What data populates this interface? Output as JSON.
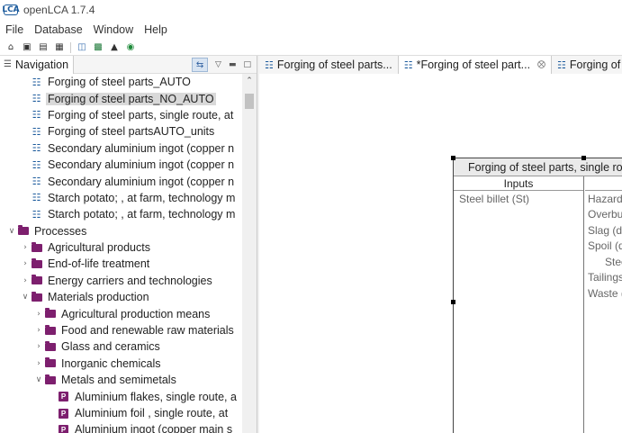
{
  "app": {
    "title": "openLCA 1.7.4",
    "logo": "LCA"
  },
  "menu": [
    "File",
    "Database",
    "Window",
    "Help"
  ],
  "toolbar_icons": [
    "home-icon",
    "save-icon",
    "save-as-icon",
    "save-all-icon",
    "console-icon",
    "excel-icon",
    "import-icon",
    "run-icon"
  ],
  "nav": {
    "title": "Navigation",
    "items": [
      {
        "label": "Forging of steel parts_AUTO",
        "type": "system",
        "level": 2
      },
      {
        "label": "Forging of steel parts_NO_AUTO",
        "type": "system",
        "level": 2,
        "selected": true
      },
      {
        "label": "Forging of steel parts, single route, at",
        "type": "system",
        "level": 2
      },
      {
        "label": "Forging of steel partsAUTO_units",
        "type": "system",
        "level": 2
      },
      {
        "label": "Secondary aluminium ingot (copper n",
        "type": "system",
        "level": 2
      },
      {
        "label": "Secondary aluminium ingot (copper n",
        "type": "system",
        "level": 2
      },
      {
        "label": "Secondary aluminium ingot (copper n",
        "type": "system",
        "level": 2
      },
      {
        "label": "Starch potato; , at farm, technology m",
        "type": "system",
        "level": 2
      },
      {
        "label": "Starch potato; , at farm, technology m",
        "type": "system",
        "level": 2
      },
      {
        "label": "Processes",
        "type": "folder",
        "level": 1,
        "expand": "open"
      },
      {
        "label": "Agricultural products",
        "type": "folder",
        "level": 2,
        "expand": "closed"
      },
      {
        "label": "End-of-life treatment",
        "type": "folder",
        "level": 2,
        "expand": "closed"
      },
      {
        "label": "Energy carriers and technologies",
        "type": "folder",
        "level": 2,
        "expand": "closed"
      },
      {
        "label": "Materials production",
        "type": "folder",
        "level": 2,
        "expand": "open"
      },
      {
        "label": "Agricultural production means",
        "type": "folder",
        "level": 3,
        "expand": "closed"
      },
      {
        "label": "Food and renewable raw materials",
        "type": "folder",
        "level": 3,
        "expand": "closed"
      },
      {
        "label": "Glass and ceramics",
        "type": "folder",
        "level": 3,
        "expand": "closed"
      },
      {
        "label": "Inorganic chemicals",
        "type": "folder",
        "level": 3,
        "expand": "closed"
      },
      {
        "label": "Metals and semimetals",
        "type": "folder",
        "level": 3,
        "expand": "open"
      },
      {
        "label": "Aluminium flakes, single route, a",
        "type": "process",
        "level": 4
      },
      {
        "label": "Aluminium foil , single route, at",
        "type": "process",
        "level": 4
      },
      {
        "label": "Aluminium ingot (copper main s",
        "type": "process",
        "level": 4
      }
    ]
  },
  "editor": {
    "tabs": [
      {
        "label": "Forging of steel parts...",
        "active": false,
        "closable": false
      },
      {
        "label": "*Forging of steel part...",
        "active": true,
        "closable": true
      },
      {
        "label": "Forging of",
        "active": false,
        "closable": false
      }
    ],
    "node": {
      "title": "Forging of steel parts, single rou",
      "inputs_header": "Inputs",
      "inputs": [
        "Steel billet (St)"
      ],
      "outputs": [
        {
          "label": "Hazard",
          "indent": false
        },
        {
          "label": "Overbu",
          "indent": false
        },
        {
          "label": "Slag (d",
          "indent": false
        },
        {
          "label": "Spoil (d",
          "indent": false
        },
        {
          "label": "Stee",
          "indent": true
        },
        {
          "label": "Tailings",
          "indent": false
        },
        {
          "label": "Waste (",
          "indent": false
        }
      ]
    }
  }
}
